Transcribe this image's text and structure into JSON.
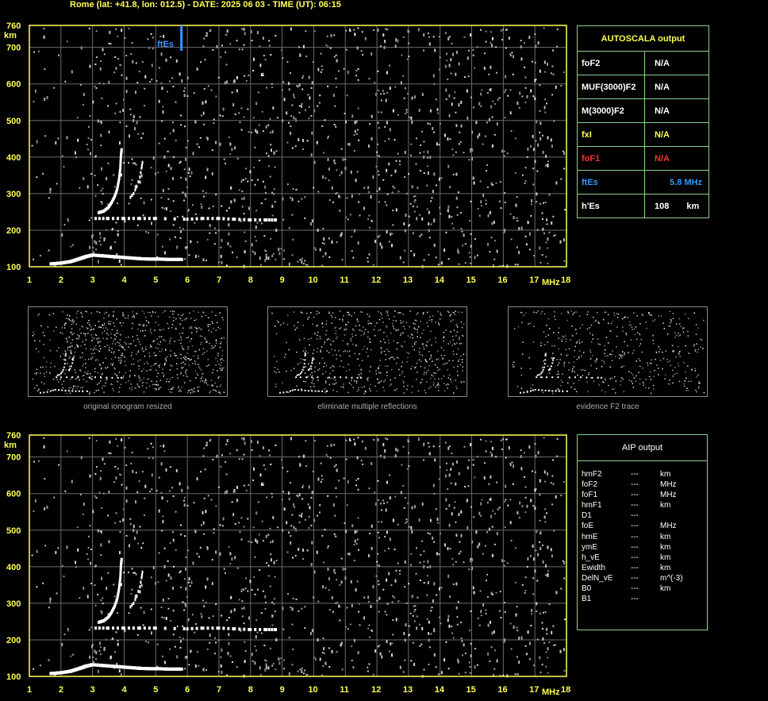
{
  "header": "Rome (lat: +41.8, lon: 012.5) - DATE: 2025 06 03 - TIME (UT): 06:15",
  "colors": {
    "axis": "#ffff55",
    "grid": "#6b6b6b",
    "trace": "#ffffff",
    "ftes": "#3399ff",
    "fof1": "#ff3030",
    "fxi": "#ffff55",
    "table_border": "#8fd08f"
  },
  "chart_data": [
    {
      "type": "scatter",
      "name": "top-ionogram",
      "x_ticks": [
        "1",
        "2",
        "3",
        "4",
        "5",
        "6",
        "7",
        "8",
        "9",
        "10",
        "11",
        "12",
        "13",
        "14",
        "15",
        "16",
        "17",
        "18"
      ],
      "x_unit": "MHz",
      "y_ticks": [
        "100",
        "200",
        "300",
        "400",
        "500",
        "600",
        "700",
        "760"
      ],
      "y_unit": "km",
      "xlim": [
        1,
        18
      ],
      "ylim": [
        100,
        760
      ],
      "grid": true,
      "marker": {
        "label": "ftEs",
        "x": 5.8
      },
      "es_trace": [
        [
          1.7,
          108
        ],
        [
          2.0,
          110
        ],
        [
          2.3,
          114
        ],
        [
          2.6,
          122
        ],
        [
          2.8,
          128
        ],
        [
          3.0,
          132
        ],
        [
          3.3,
          130
        ],
        [
          3.6,
          128
        ],
        [
          3.9,
          126
        ],
        [
          4.2,
          124
        ],
        [
          4.5,
          122
        ],
        [
          4.8,
          121
        ],
        [
          5.1,
          121
        ],
        [
          5.4,
          120
        ],
        [
          5.8,
          120
        ]
      ],
      "f_trace": [
        [
          3.2,
          248
        ],
        [
          3.35,
          252
        ],
        [
          3.5,
          262
        ],
        [
          3.6,
          275
        ],
        [
          3.7,
          292
        ],
        [
          3.78,
          312
        ],
        [
          3.84,
          340
        ],
        [
          3.88,
          370
        ],
        [
          3.9,
          405
        ],
        [
          3.92,
          420
        ]
      ],
      "f_trace2": [
        [
          4.2,
          290
        ],
        [
          4.3,
          300
        ],
        [
          4.4,
          320
        ],
        [
          4.5,
          345
        ],
        [
          4.55,
          370
        ],
        [
          4.58,
          385
        ]
      ],
      "es_multiple": [
        [
          3.1,
          232
        ],
        [
          3.5,
          232
        ],
        [
          4.0,
          232
        ],
        [
          4.5,
          232
        ],
        [
          5.0,
          232
        ],
        [
          6.0,
          230
        ],
        [
          6.5,
          232
        ],
        [
          7.0,
          232
        ],
        [
          7.5,
          230
        ],
        [
          8.0,
          228
        ],
        [
          8.5,
          228
        ],
        [
          8.8,
          228
        ]
      ]
    },
    {
      "type": "scatter",
      "name": "bottom-ionogram",
      "x_ticks": [
        "1",
        "2",
        "3",
        "4",
        "5",
        "6",
        "7",
        "8",
        "9",
        "10",
        "11",
        "12",
        "13",
        "14",
        "15",
        "16",
        "17",
        "18"
      ],
      "x_unit": "MHz",
      "y_ticks": [
        "100",
        "200",
        "300",
        "400",
        "500",
        "600",
        "700",
        "760"
      ],
      "y_unit": "km",
      "xlim": [
        1,
        18
      ],
      "ylim": [
        100,
        760
      ],
      "grid": true
    }
  ],
  "autoscala": {
    "title": "AUTOSCALA output",
    "rows": [
      {
        "key": "foF2",
        "value": "N/A",
        "unit": "",
        "color": "#ffffff"
      },
      {
        "key": "MUF(3000)F2",
        "value": "N/A",
        "unit": "",
        "color": "#ffffff"
      },
      {
        "key": "M(3000)F2",
        "value": "N/A",
        "unit": "",
        "color": "#ffffff"
      },
      {
        "key": "fxI",
        "value": "N/A",
        "unit": "",
        "color": "#ffff55"
      },
      {
        "key": "foF1",
        "value": "N/A",
        "unit": "",
        "color": "#ff3030"
      },
      {
        "key": "ftEs",
        "value": "5.8 MHz",
        "unit": "",
        "color": "#3399ff"
      },
      {
        "key": "h'Es",
        "value": "108",
        "unit": "km",
        "color": "#ffffff"
      }
    ]
  },
  "thumbnails": [
    {
      "caption": "original ionogram resized"
    },
    {
      "caption": "eliminate multiple reflections"
    },
    {
      "caption": "evidence F2 trace"
    }
  ],
  "aip": {
    "title": "AIP output",
    "rows": [
      [
        "hmF2",
        "---",
        "km"
      ],
      [
        "foF2",
        "---",
        "MHz"
      ],
      [
        "foF1",
        "---",
        "MHz"
      ],
      [
        "hmF1",
        "---",
        "km"
      ],
      [
        "D1",
        "---",
        ""
      ],
      [
        "foE",
        "---",
        "MHz"
      ],
      [
        "hmE",
        "---",
        "km"
      ],
      [
        "ymE",
        "---",
        "km"
      ],
      [
        "h_vE",
        "---",
        "km"
      ],
      [
        "Ewidth",
        "---",
        "km"
      ],
      [
        "DelN_vE",
        "---",
        "m^(-3)"
      ],
      [
        "B0",
        "---",
        "km"
      ],
      [
        "B1",
        "---",
        ""
      ]
    ]
  }
}
